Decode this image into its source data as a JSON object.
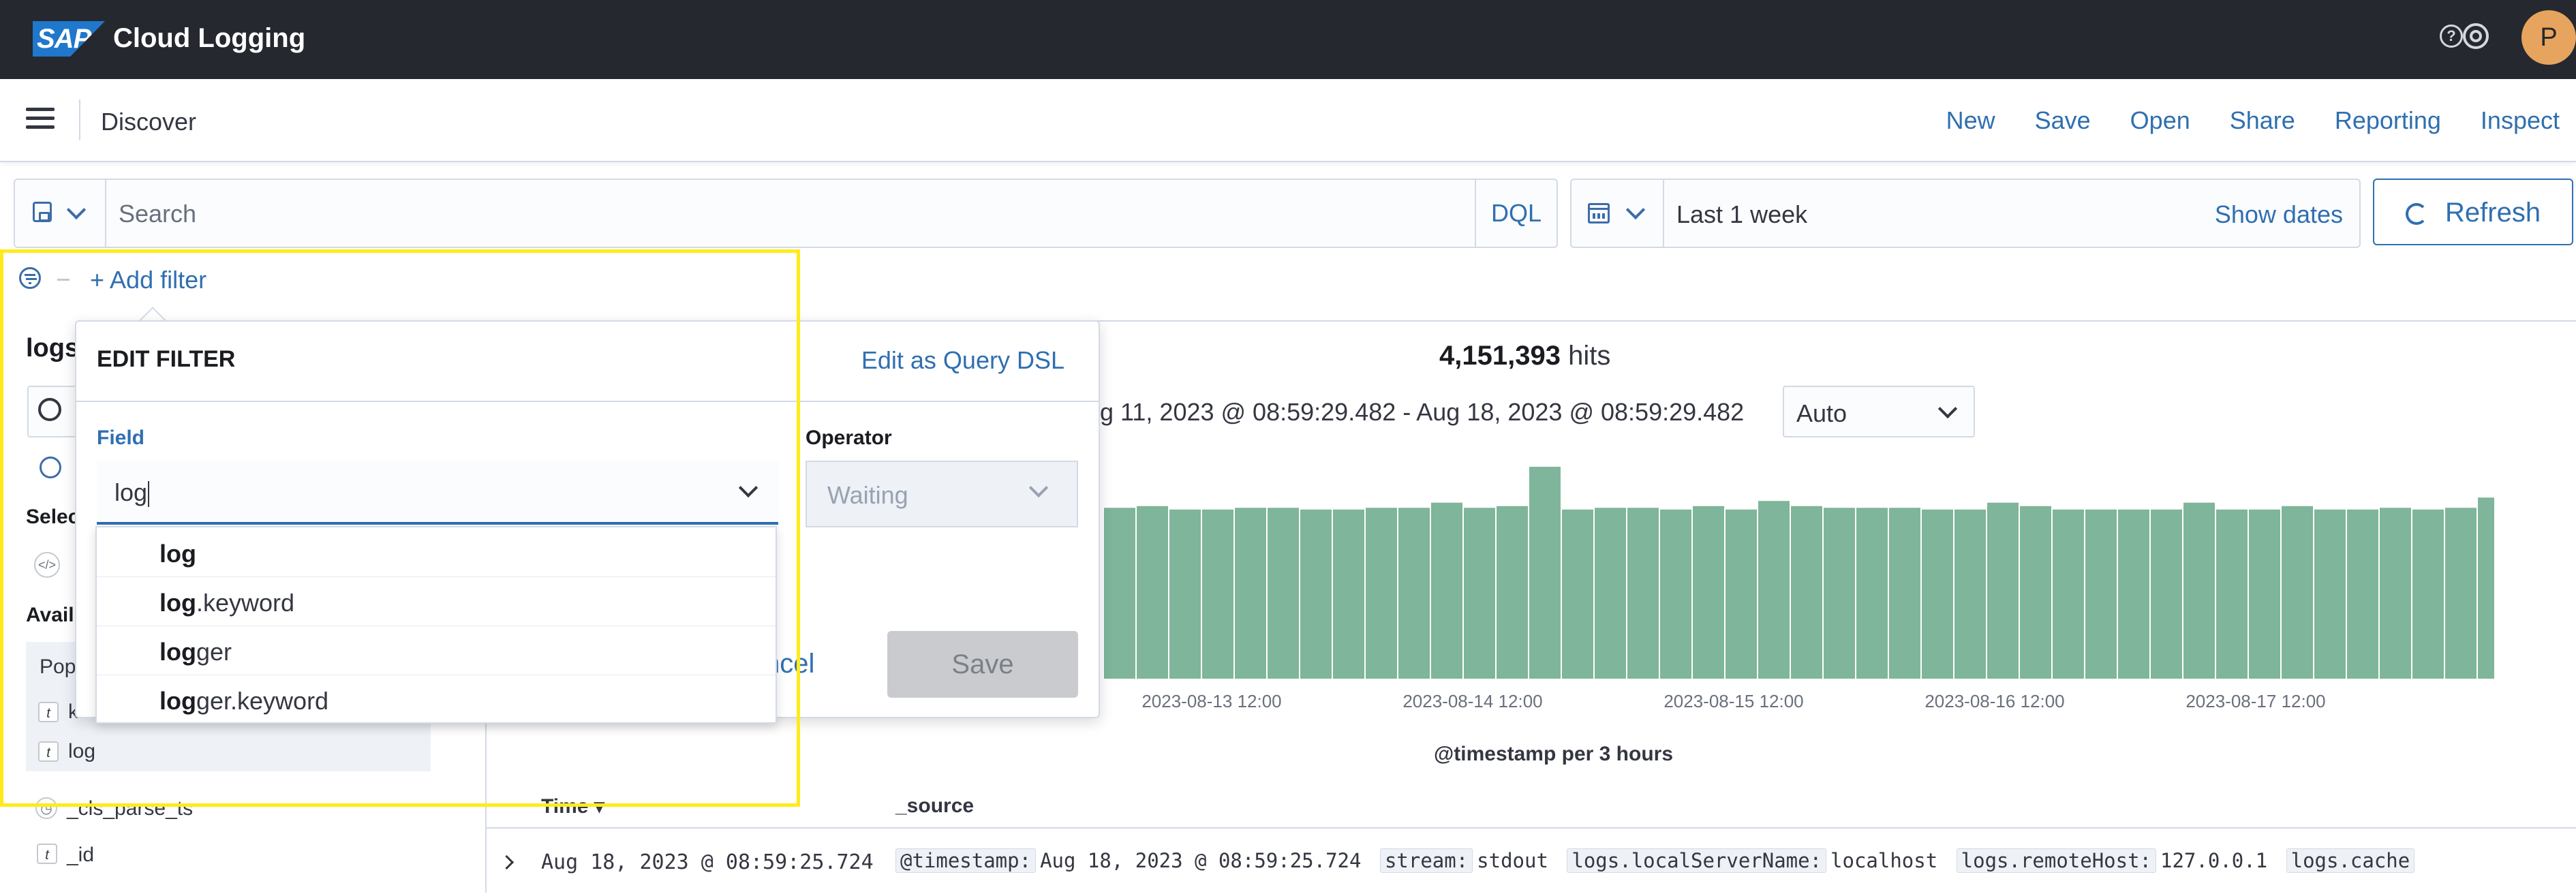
{
  "app": {
    "logo_text": "SAP",
    "title": "Cloud Logging",
    "avatar_initial": "P"
  },
  "header": {
    "page_title": "Discover",
    "nav": [
      "New",
      "Save",
      "Open",
      "Share",
      "Reporting",
      "Inspect"
    ]
  },
  "query": {
    "placeholder": "Search",
    "language": "DQL"
  },
  "time": {
    "range": "Last 1 week",
    "show_dates": "Show dates",
    "refresh": "Refresh"
  },
  "filters": {
    "add_filter": "+ Add filter"
  },
  "sidebar": {
    "index_title": "logs",
    "selected_fields": "Selec",
    "available_fields": "Avail",
    "popular": "Pop",
    "popular_fields": [
      {
        "type": "t",
        "name": "k"
      },
      {
        "type": "t",
        "name": "log"
      }
    ],
    "fields": [
      {
        "name": "_cls_parse_ts"
      },
      {
        "type": "t",
        "name": "_id"
      }
    ]
  },
  "results": {
    "hits_count": "4,151,393",
    "hits_label": "hits",
    "date_range": "ug 11, 2023 @ 08:59:29.482 - Aug 18, 2023 @ 08:59:29.482",
    "interval": "Auto",
    "columns": {
      "time": "Time",
      "source": "_source"
    },
    "rows": [
      {
        "time": "Aug 18, 2023 @ 08:59:25.724",
        "source": [
          {
            "key": "@timestamp:",
            "value": "Aug 18, 2023 @ 08:59:25.724"
          },
          {
            "key": "stream:",
            "value": "stdout"
          },
          {
            "key": "logs.localServerName:",
            "value": "localhost"
          },
          {
            "key": "logs.remoteHost:",
            "value": "127.0.0.1"
          },
          {
            "key": "logs.cache",
            "value": ""
          }
        ]
      }
    ]
  },
  "chart_data": {
    "type": "bar",
    "xlabel": "@timestamp per 3 hours",
    "x_tick_labels": [
      "2023-08-13 12:00",
      "2023-08-14 12:00",
      "2023-08-15 12:00",
      "2023-08-16 12:00",
      "2023-08-17 12:00"
    ],
    "bar_color": "#7fb59a",
    "marker_color": "#e7664c",
    "values": [
      1000,
      1010,
      990,
      990,
      1000,
      1000,
      990,
      990,
      1000,
      1000,
      1030,
      1000,
      1010,
      1240,
      990,
      1000,
      1000,
      990,
      1010,
      990,
      1040,
      1010,
      1000,
      1000,
      1000,
      990,
      990,
      1030,
      1010,
      990,
      990,
      990,
      990,
      1030,
      990,
      990,
      1010,
      990,
      990,
      1000,
      990,
      1000,
      1060,
      990,
      1000,
      1040,
      1060,
      1000
    ],
    "ylim": [
      0,
      1300
    ]
  },
  "edit_filter": {
    "title": "EDIT FILTER",
    "edit_as_dsl": "Edit as Query DSL",
    "field_label": "Field",
    "field_value": "log",
    "operator_label": "Operator",
    "operator_value": "Waiting",
    "cancel": "ncel",
    "save": "Save",
    "suggestions": [
      {
        "match": "log",
        "rest": ""
      },
      {
        "match": "log",
        "rest": ".keyword"
      },
      {
        "match": "log",
        "rest": "ger"
      },
      {
        "match": "log",
        "rest": "ger.keyword"
      }
    ]
  },
  "colors": {
    "accent": "#2f6fb1",
    "appbar": "#25282f",
    "highlight": "#ffeb1a"
  }
}
